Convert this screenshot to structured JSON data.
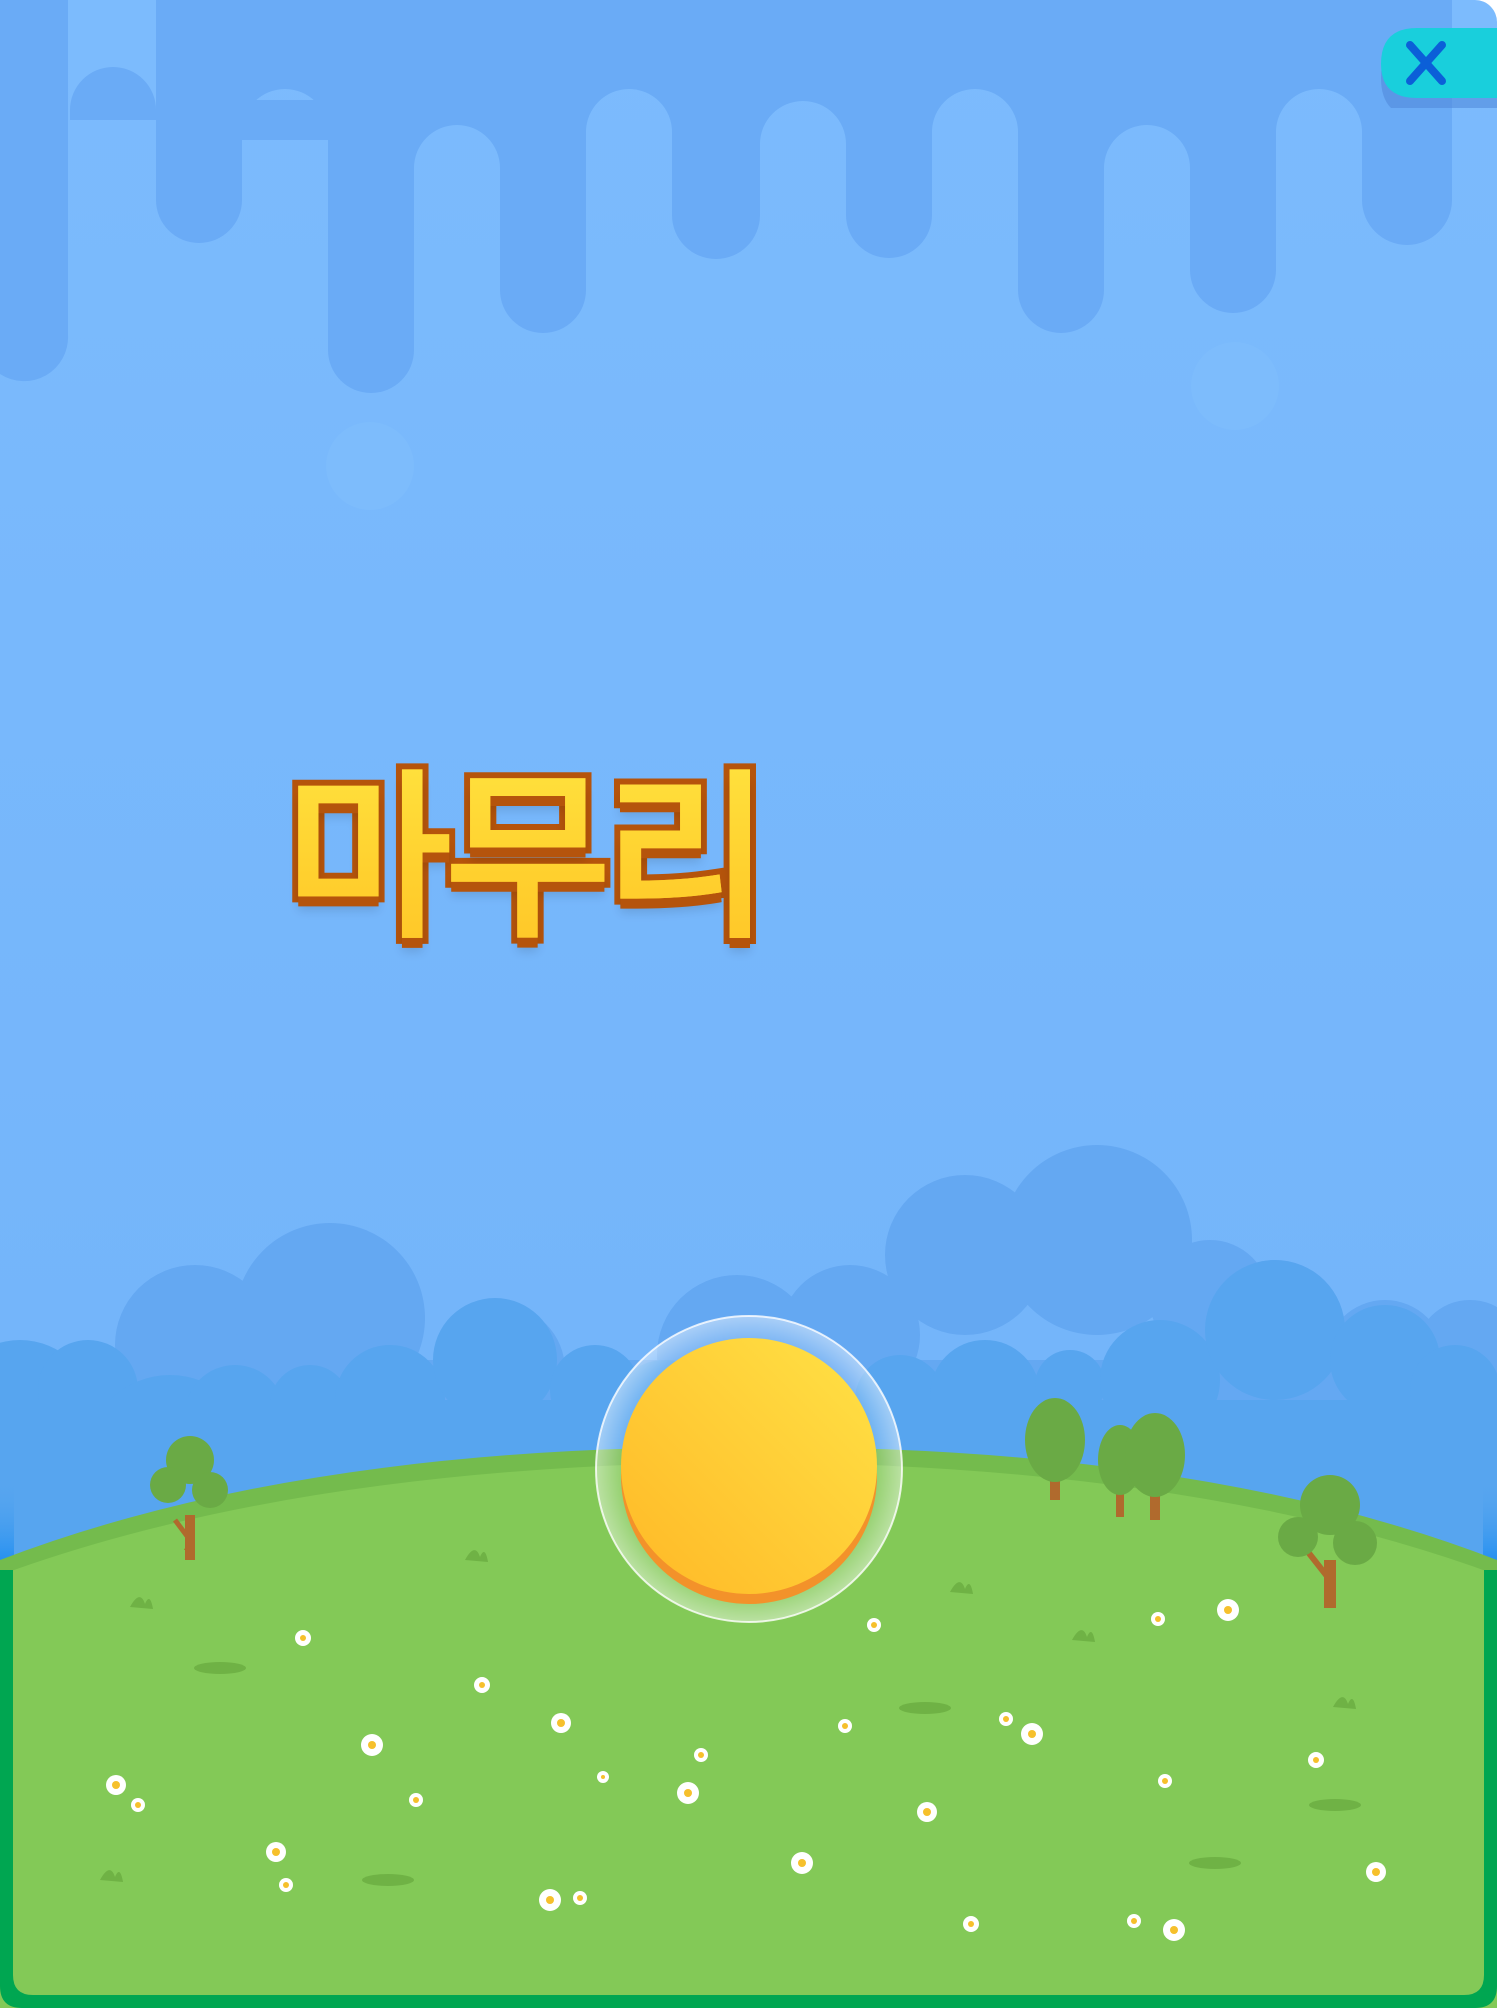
{
  "screen": {
    "title": "마무리",
    "colors": {
      "sky": "#74b5fb",
      "sky_top": "#7cbbfd",
      "drips": "#6aabf6",
      "clouds_back": "#64a8f2",
      "clouds_front": "#57a5ef",
      "grass": "#83c957",
      "grass_rim": "#74bb4d",
      "frame_border": "#00a651",
      "title_fill": "#ffd02e",
      "title_outline": "#b5540c",
      "button_fill": "#ffcc2f",
      "button_shadow": "#f3922a",
      "close_button": "#19cfdc",
      "close_icon": "#0b5fd8"
    }
  },
  "controls": {
    "close": {
      "icon": "close-x-icon",
      "action": "close"
    },
    "start": {
      "icon": "yellow-circle-button"
    }
  }
}
